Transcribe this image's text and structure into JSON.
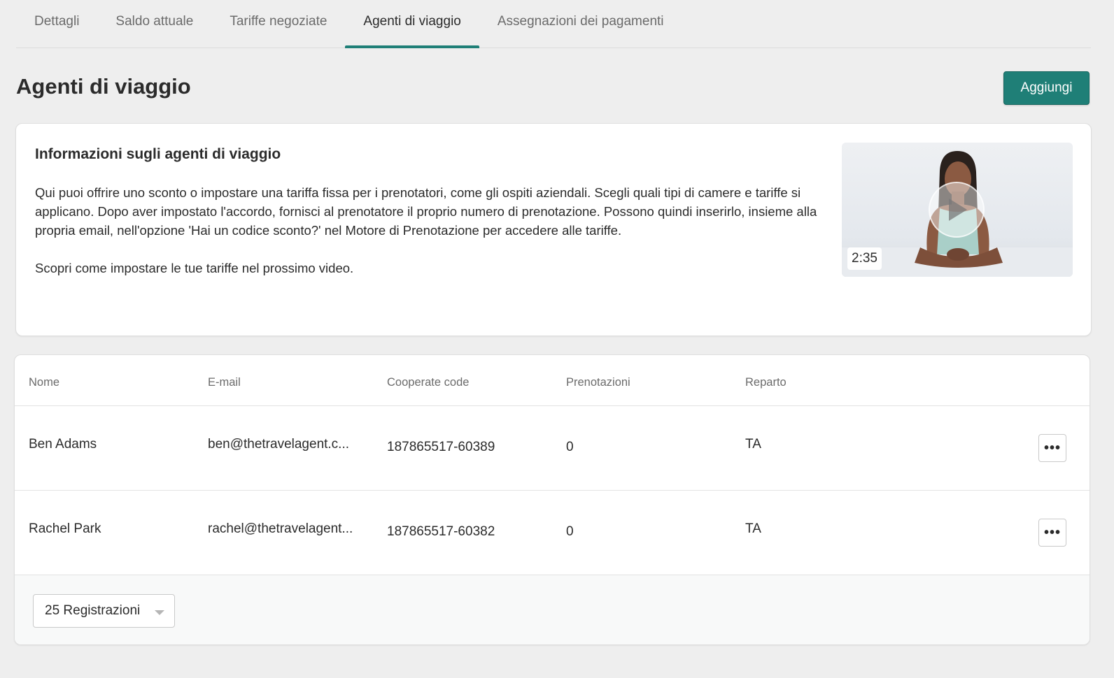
{
  "tabs": [
    {
      "label": "Dettagli",
      "active": false
    },
    {
      "label": "Saldo attuale",
      "active": false
    },
    {
      "label": "Tariffe negoziate",
      "active": false
    },
    {
      "label": "Agenti di viaggio",
      "active": true
    },
    {
      "label": "Assegnazioni dei pagamenti",
      "active": false
    }
  ],
  "header": {
    "title": "Agenti di viaggio",
    "add_label": "Aggiungi"
  },
  "info": {
    "title": "Informazioni sugli agenti di viaggio",
    "paragraph1": "Qui puoi offrire uno sconto o impostare una tariffa fissa per i prenotatori, come gli ospiti aziendali. Scegli quali tipi di camere e tariffe si applicano. Dopo aver impostato l'accordo, fornisci al prenotatore il proprio numero di prenotazione. Possono quindi inserirlo, insieme alla propria email, nell'opzione 'Hai un codice sconto?' nel Motore di Prenotazione per accedere alle tariffe.",
    "paragraph2": "Scopri come impostare le tue tariffe nel prossimo video.",
    "video_duration": "2:35"
  },
  "table": {
    "columns": [
      "Nome",
      "E-mail",
      "Cooperate code",
      "Prenotazioni",
      "Reparto"
    ],
    "rows": [
      {
        "name": "Ben Adams",
        "email": "ben@thetravelagent.c...",
        "code": "187865517-60389",
        "bookings": "0",
        "department": "TA"
      },
      {
        "name": "Rachel Park",
        "email": "rachel@thetravelagent...",
        "code": "187865517-60382",
        "bookings": "0",
        "department": "TA"
      }
    ],
    "more_label": "•••",
    "page_size": "25 Registrazioni"
  },
  "colors": {
    "accent": "#1f7f77",
    "background": "#eeeeee"
  }
}
